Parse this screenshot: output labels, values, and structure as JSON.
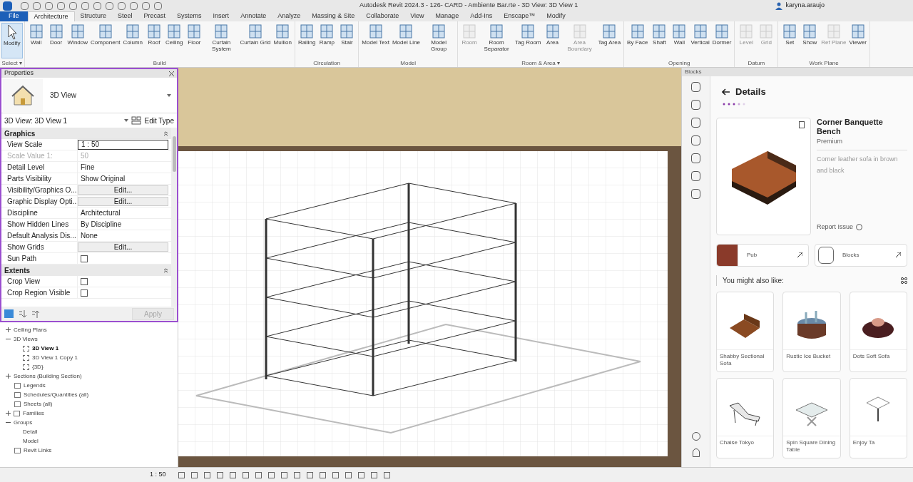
{
  "window": {
    "title": "Autodesk Revit 2024.3 - 126- CARD - Ambiente Bar.rte - 3D View: 3D View 1",
    "user": "karyna.araujo"
  },
  "tabs": [
    {
      "label": "File",
      "selected": false,
      "kind": "file"
    },
    {
      "label": "Architecture",
      "selected": true,
      "kind": "tab"
    },
    {
      "label": "Structure",
      "selected": false,
      "kind": "tab"
    },
    {
      "label": "Steel",
      "selected": false,
      "kind": "tab"
    },
    {
      "label": "Precast",
      "selected": false,
      "kind": "tab"
    },
    {
      "label": "Systems",
      "selected": false,
      "kind": "tab"
    },
    {
      "label": "Insert",
      "selected": false,
      "kind": "tab"
    },
    {
      "label": "Annotate",
      "selected": false,
      "kind": "tab"
    },
    {
      "label": "Analyze",
      "selected": false,
      "kind": "tab"
    },
    {
      "label": "Massing & Site",
      "selected": false,
      "kind": "tab"
    },
    {
      "label": "Collaborate",
      "selected": false,
      "kind": "tab"
    },
    {
      "label": "View",
      "selected": false,
      "kind": "tab"
    },
    {
      "label": "Manage",
      "selected": false,
      "kind": "tab"
    },
    {
      "label": "Add-Ins",
      "selected": false,
      "kind": "tab"
    },
    {
      "label": "Enscape™",
      "selected": false,
      "kind": "tab"
    },
    {
      "label": "Modify",
      "selected": false,
      "kind": "tab"
    }
  ],
  "ribbon": [
    {
      "label": "Select ▾",
      "tools": [
        {
          "label": "Modify",
          "selected": true,
          "disabled": false
        }
      ]
    },
    {
      "label": "Build",
      "tools": [
        {
          "label": "Wall",
          "selected": false,
          "disabled": false
        },
        {
          "label": "Door",
          "selected": false,
          "disabled": false
        },
        {
          "label": "Window",
          "selected": false,
          "disabled": false
        },
        {
          "label": "Component",
          "selected": false,
          "disabled": false
        },
        {
          "label": "Column",
          "selected": false,
          "disabled": false
        },
        {
          "label": "Roof",
          "selected": false,
          "disabled": false
        },
        {
          "label": "Ceiling",
          "selected": false,
          "disabled": false
        },
        {
          "label": "Floor",
          "selected": false,
          "disabled": false
        },
        {
          "label": "Curtain System",
          "selected": false,
          "disabled": false
        },
        {
          "label": "Curtain Grid",
          "selected": false,
          "disabled": false
        },
        {
          "label": "Mullion",
          "selected": false,
          "disabled": false
        }
      ]
    },
    {
      "label": "Circulation",
      "tools": [
        {
          "label": "Railing",
          "selected": false,
          "disabled": false
        },
        {
          "label": "Ramp",
          "selected": false,
          "disabled": false
        },
        {
          "label": "Stair",
          "selected": false,
          "disabled": false
        }
      ]
    },
    {
      "label": "Model",
      "tools": [
        {
          "label": "Model Text",
          "selected": false,
          "disabled": false
        },
        {
          "label": "Model Line",
          "selected": false,
          "disabled": false
        },
        {
          "label": "Model Group",
          "selected": false,
          "disabled": false
        }
      ]
    },
    {
      "label": "Room & Area ▾",
      "tools": [
        {
          "label": "Room",
          "selected": false,
          "disabled": true
        },
        {
          "label": "Room Separator",
          "selected": false,
          "disabled": false
        },
        {
          "label": "Tag Room",
          "selected": false,
          "disabled": false
        },
        {
          "label": "Area",
          "selected": false,
          "disabled": false
        },
        {
          "label": "Area Boundary",
          "selected": false,
          "disabled": true
        },
        {
          "label": "Tag Area",
          "selected": false,
          "disabled": false
        }
      ]
    },
    {
      "label": "Opening",
      "tools": [
        {
          "label": "By Face",
          "selected": false,
          "disabled": false
        },
        {
          "label": "Shaft",
          "selected": false,
          "disabled": false
        },
        {
          "label": "Wall",
          "selected": false,
          "disabled": false
        },
        {
          "label": "Vertical",
          "selected": false,
          "disabled": false
        },
        {
          "label": "Dormer",
          "selected": false,
          "disabled": false
        }
      ]
    },
    {
      "label": "Datum",
      "tools": [
        {
          "label": "Level",
          "selected": false,
          "disabled": true
        },
        {
          "label": "Grid",
          "selected": false,
          "disabled": true
        }
      ]
    },
    {
      "label": "Work Plane",
      "tools": [
        {
          "label": "Set",
          "selected": false,
          "disabled": false
        },
        {
          "label": "Show",
          "selected": false,
          "disabled": false
        },
        {
          "label": "Ref Plane",
          "selected": false,
          "disabled": true
        },
        {
          "label": "Viewer",
          "selected": false,
          "disabled": false
        }
      ]
    }
  ],
  "properties": {
    "title": "Properties",
    "type_name": "3D View",
    "instance": "3D View: 3D View 1",
    "edit_type": "Edit Type",
    "apply": "Apply",
    "sections": [
      {
        "title": "Graphics",
        "rows": [
          {
            "label": "View Scale",
            "kind": "input",
            "value": "1 : 50"
          },
          {
            "label": "Scale Value    1:",
            "kind": "disabled",
            "value": "50"
          },
          {
            "label": "Detail Level",
            "kind": "text",
            "value": "Fine"
          },
          {
            "label": "Parts Visibility",
            "kind": "text",
            "value": "Show Original"
          },
          {
            "label": "Visibility/Graphics O...",
            "kind": "button",
            "value": "Edit..."
          },
          {
            "label": "Graphic Display Opti...",
            "kind": "button",
            "value": "Edit..."
          },
          {
            "label": "Discipline",
            "kind": "text",
            "value": "Architectural"
          },
          {
            "label": "Show Hidden Lines",
            "kind": "text",
            "value": "By Discipline"
          },
          {
            "label": "Default Analysis Dis...",
            "kind": "text",
            "value": "None"
          },
          {
            "label": "Show Grids",
            "kind": "button",
            "value": "Edit..."
          },
          {
            "label": "Sun Path",
            "kind": "checkbox",
            "checked": false
          }
        ]
      },
      {
        "title": "Extents",
        "rows": [
          {
            "label": "Crop View",
            "kind": "checkbox",
            "checked": false
          },
          {
            "label": "Crop Region Visible",
            "kind": "checkbox",
            "checked": false
          }
        ]
      }
    ]
  },
  "browser": [
    {
      "label": "Ceiling Plans",
      "kind": "folder",
      "expanded": false
    },
    {
      "label": "3D Views",
      "kind": "folder",
      "expanded": true,
      "children": [
        {
          "label": "3D View 1",
          "kind": "view",
          "selected": true
        },
        {
          "label": "3D View 1 Copy 1",
          "kind": "view",
          "selected": false
        },
        {
          "label": "{3D}",
          "kind": "view",
          "selected": false
        }
      ]
    },
    {
      "label": "Sections (Building Section)",
      "kind": "folder",
      "expanded": false
    },
    {
      "label": "Legends",
      "kind": "leaf"
    },
    {
      "label": "Schedules/Quantities (all)",
      "kind": "leaf"
    },
    {
      "label": "Sheets (all)",
      "kind": "leaf"
    },
    {
      "label": "Families",
      "kind": "folder",
      "expanded": false
    },
    {
      "label": "Groups",
      "kind": "folder",
      "expanded": true,
      "children": [
        {
          "label": "Detail",
          "kind": "plain"
        },
        {
          "label": "Model",
          "kind": "plain"
        }
      ]
    },
    {
      "label": "Revit Links",
      "kind": "leaf"
    }
  ],
  "status_bar": {
    "scale": "1 : 50"
  },
  "blocks": {
    "title": "Blocks",
    "heading": "Details",
    "name": "Corner Banquette Bench",
    "tier": "Premium",
    "description": "Corner leather sofa in brown and black",
    "report": "Report Issue",
    "links": [
      {
        "label": "Pub",
        "kind": "pub"
      },
      {
        "label": "Blocks",
        "kind": "blocks"
      }
    ],
    "also_like": "You might also like:",
    "items": [
      {
        "label": "Shabby Sectional Sofa",
        "kind": "sofa"
      },
      {
        "label": "Rustic Ice Bucket",
        "kind": "bucket"
      },
      {
        "label": "Dots Soft Sofa",
        "kind": "pouf"
      },
      {
        "label": "Chaise Tokyo",
        "kind": "chaise"
      },
      {
        "label": "Spin Square Dining Table",
        "kind": "table"
      },
      {
        "label": "Enjoy Ta",
        "kind": "lamp"
      }
    ]
  }
}
